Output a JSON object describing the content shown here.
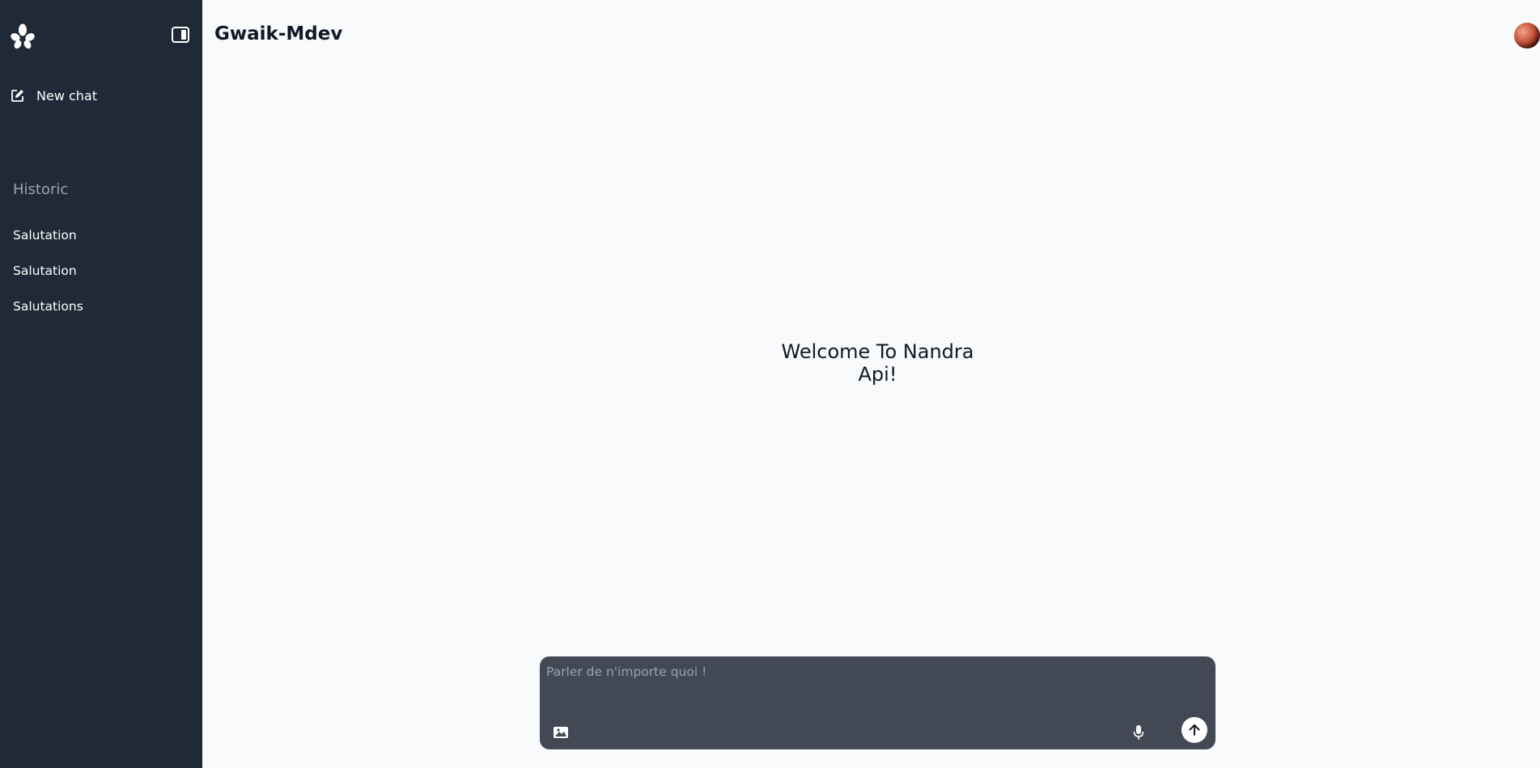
{
  "app": {
    "title": "Gwaik-Mdev",
    "welcome": "Welcome To Nandra Api!"
  },
  "sidebar": {
    "logo_icon": "flower-logo-icon",
    "toggle_icon": "sidebar-toggle-icon",
    "new_chat": {
      "label": "New chat",
      "icon": "edit-icon"
    },
    "historic_title": "Historic",
    "items": [
      {
        "label": "Salutation"
      },
      {
        "label": "Salutation"
      },
      {
        "label": "Salutations"
      }
    ]
  },
  "composer": {
    "placeholder": "Parler de n'importe quoi !",
    "value": "",
    "image_icon": "image-icon",
    "mic_icon": "microphone-icon",
    "send_icon": "arrow-up-icon"
  },
  "colors": {
    "sidebar_bg": "#1f2937",
    "main_bg": "#f8fafc",
    "composer_bg": "#424954",
    "muted_text": "#9ca3af"
  }
}
